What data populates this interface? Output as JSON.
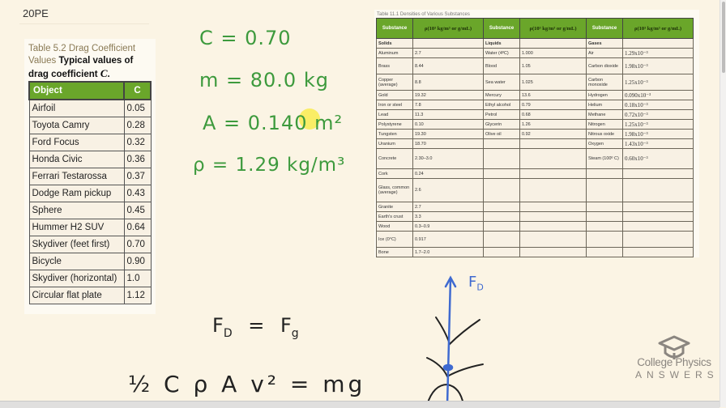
{
  "page": {
    "label": "20PE"
  },
  "drag_table": {
    "caption_number": "Table 5.2 Drag Coefficient Values",
    "caption_desc": "Typical values of drag coefficient",
    "caption_symbol": "C",
    "caption_end": ".",
    "headers": [
      "Object",
      "C"
    ],
    "rows": [
      {
        "object": "Airfoil",
        "c": "0.05"
      },
      {
        "object": "Toyota Camry",
        "c": "0.28"
      },
      {
        "object": "Ford Focus",
        "c": "0.32"
      },
      {
        "object": "Honda Civic",
        "c": "0.36"
      },
      {
        "object": "Ferrari Testarossa",
        "c": "0.37"
      },
      {
        "object": "Dodge Ram pickup",
        "c": "0.43"
      },
      {
        "object": "Sphere",
        "c": "0.45"
      },
      {
        "object": "Hummer H2 SUV",
        "c": "0.64"
      },
      {
        "object": "Skydiver (feet first)",
        "c": "0.70"
      },
      {
        "object": "Bicycle",
        "c": "0.90"
      },
      {
        "object": "Skydiver (horizontal)",
        "c": "1.0"
      },
      {
        "object": "Circular flat plate",
        "c": "1.12"
      }
    ],
    "header_color": "#6aa62a"
  },
  "density_table": {
    "caption": "Table 11.1 Densities of Various Substances",
    "headers": [
      "Substance",
      "ρ(10³ kg/m³ or g/mL)",
      "Substance",
      "ρ(10³ kg/m³ or g/mL)",
      "Substance",
      "ρ(10³ kg/m³ or g/mL)"
    ],
    "rows": [
      [
        "Solids",
        "",
        "Liquids",
        "",
        "Gases",
        ""
      ],
      [
        "Aluminum",
        "2.7",
        "Water (4ºC)",
        "1.000",
        "Air",
        "1.29x10⁻³"
      ],
      [
        "Brass",
        "8.44",
        "Blood",
        "1.05",
        "Carbon dioxide",
        "1.98x10⁻³"
      ],
      [
        "Copper (average)",
        "8.8",
        "Sea water",
        "1.025",
        "Carbon monoxide",
        "1.25x10⁻³"
      ],
      [
        "Gold",
        "19.32",
        "Mercury",
        "13.6",
        "Hydrogen",
        "0.090x10⁻³"
      ],
      [
        "Iron or steel",
        "7.8",
        "Ethyl alcohol",
        "0.79",
        "Helium",
        "0.18x10⁻³"
      ],
      [
        "Lead",
        "11.3",
        "Petrol",
        "0.68",
        "Methane",
        "0.72x10⁻³"
      ],
      [
        "Polystyrene",
        "0.10",
        "Glycerin",
        "1.26",
        "Nitrogen",
        "1.25x10⁻³"
      ],
      [
        "Tungsten",
        "19.30",
        "Olive oil",
        "0.92",
        "Nitrous oxide",
        "1.98x10⁻³"
      ],
      [
        "Uranium",
        "18.70",
        "",
        "",
        "Oxygen",
        "1.43x10⁻³"
      ],
      [
        "Concrete",
        "2.30–3.0",
        "",
        "",
        "Steam (100º C)",
        "0.60x10⁻³"
      ],
      [
        "Cork",
        "0.24",
        "",
        "",
        "",
        ""
      ],
      [
        "Glass, common (average)",
        "2.6",
        "",
        "",
        "",
        ""
      ],
      [
        "Granite",
        "2.7",
        "",
        "",
        "",
        ""
      ],
      [
        "Earth's crust",
        "3.3",
        "",
        "",
        "",
        ""
      ],
      [
        "Wood",
        "0.3–0.9",
        "",
        "",
        "",
        ""
      ],
      [
        "Ice (0°C)",
        "0.917",
        "",
        "",
        "",
        ""
      ],
      [
        "Bone",
        "1.7–2.0",
        "",
        "",
        "",
        ""
      ]
    ]
  },
  "handwriting": {
    "given": [
      "C = 0.70",
      "m = 80.0 kg",
      "A = 0.140 m²",
      "ρ = 1.29 kg/m³"
    ],
    "equation1": "F_D = F_g",
    "equation1_lhs": "F",
    "equation1_lhs_sub": "D",
    "equation1_eq": "=",
    "equation1_rhs": "F",
    "equation1_rhs_sub": "g",
    "equation2": "½ C ρ A v² = mg",
    "diagram_force_label": "F",
    "diagram_force_sub": "D",
    "colors": {
      "given": "#3d9a3d",
      "equations": "#222222",
      "diagram_arrow": "#3f6ad0"
    }
  },
  "logo": {
    "line1": "College Physics",
    "line2": "ANSWERS"
  }
}
